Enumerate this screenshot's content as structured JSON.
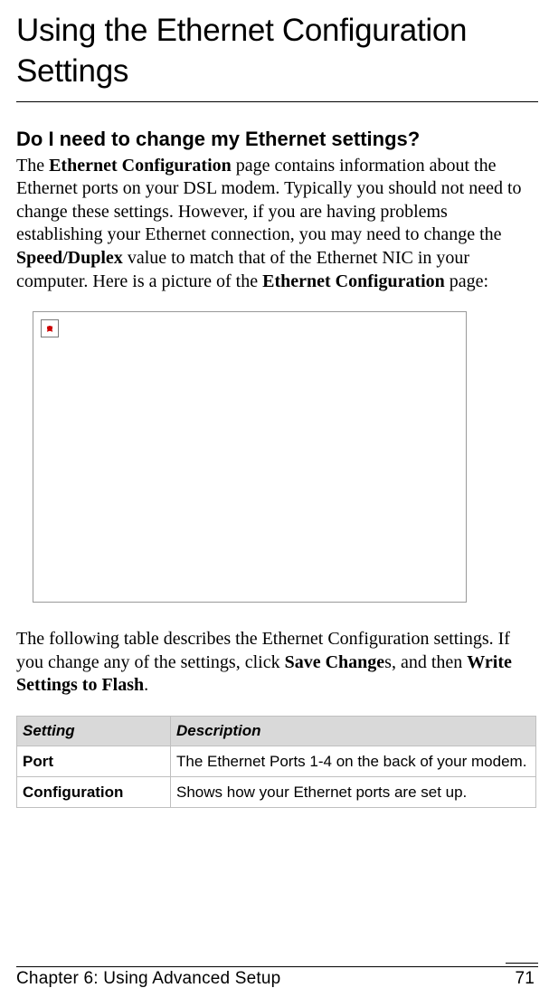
{
  "title": "Using the Ethernet Configuration Settings",
  "section_heading": "Do I need to change my Ethernet settings?",
  "para1_parts": {
    "a": "The ",
    "b": "Ethernet Configuration",
    "c": " page contains information about the Ethernet ports on your DSL modem. Typically you should not need to change these settings. However, if you are having problems establishing your Ethernet connection, you may need to change the ",
    "d": "Speed/Duplex",
    "e": " value to match that of the Ethernet NIC in your computer. Here is a picture of the ",
    "f": "Ethernet Configuration",
    "g": " page:"
  },
  "para2_parts": {
    "a": "The following table describes the Ethernet Configuration settings. If you change any of the settings, click ",
    "b": "Save Change",
    "c": "s, and then ",
    "d": "Write Settings to Flash",
    "e": "."
  },
  "table": {
    "headers": {
      "setting": "Setting",
      "description": "Description"
    },
    "rows": [
      {
        "setting": "Port",
        "description": "The Ethernet Ports 1-4 on the back of your modem."
      },
      {
        "setting": "Configuration",
        "description": "Shows how your Ethernet ports are set up."
      }
    ]
  },
  "footer": {
    "chapter": "Chapter 6: Using Advanced Setup",
    "page": "71"
  }
}
